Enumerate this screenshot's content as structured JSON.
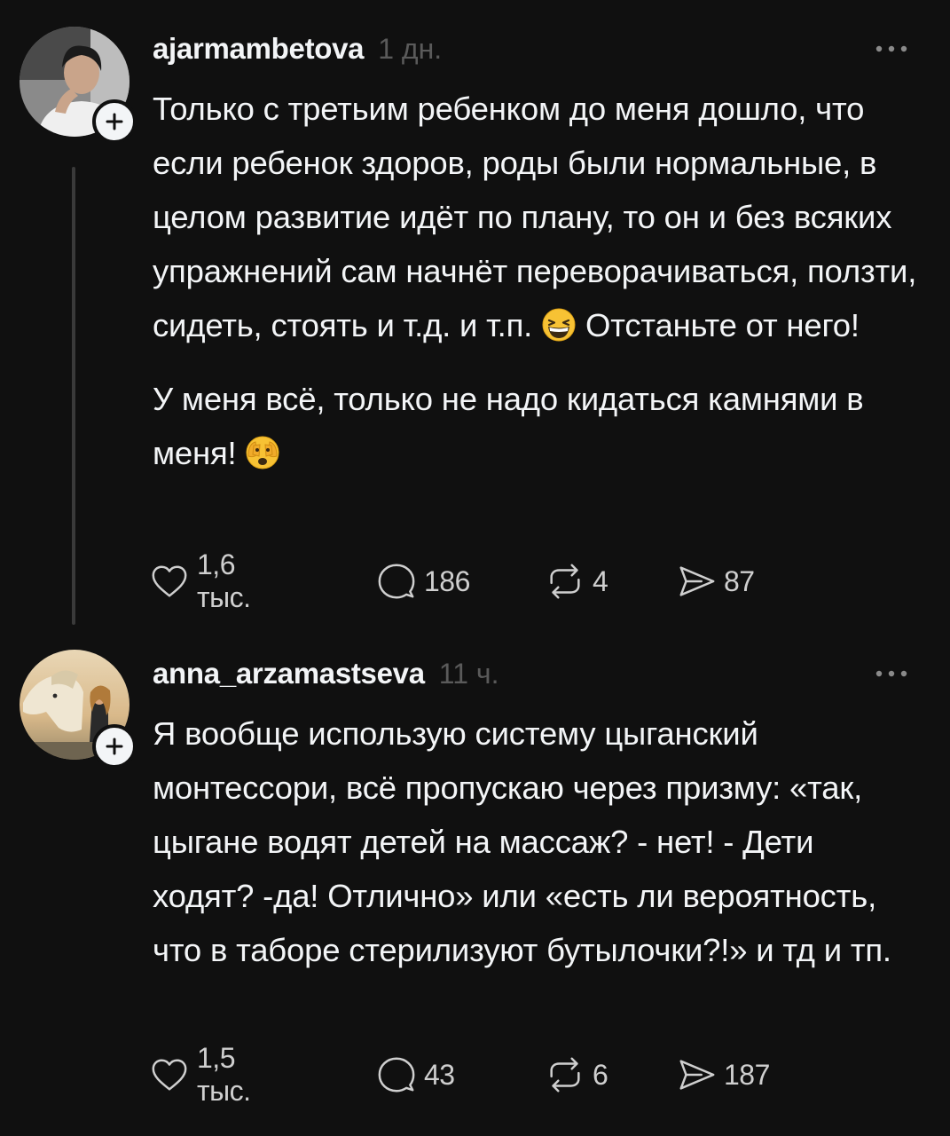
{
  "posts": [
    {
      "username": "ajarmambetova",
      "time": "1 дн.",
      "paragraphs": [
        {
          "text": "Только с третьим ребенком до меня дошло, что если ребенок здоров, роды были нормальные, в целом развитие идёт по плану, то он и без всяких упражнений сам начнёт переворачиваться, ползти, сидеть, стоять и т.д. и т.п.",
          "emoji": "grinning-squinting-face-emoji",
          "after": "Отстаньте от него!"
        },
        {
          "text": "У меня всё, только не надо кидаться камнями в меня!",
          "emoji": "face-with-peeking-eye-emoji",
          "after": ""
        }
      ],
      "likes": "1,6 тыс.",
      "replies": "186",
      "reposts": "4",
      "shares": "87"
    },
    {
      "username": "anna_arzamastseva",
      "time": "11 ч.",
      "paragraphs": [
        {
          "text": "Я вообще использую систему цыганский монтессори, всё пропускаю через призму: «так, цыгане водят детей на массаж? - нет! - Дети ходят? -да! Отлично» или «есть ли вероятность, что в таборе стерилизуют бутылочки?!» и тд и тп.",
          "emoji": "",
          "after": ""
        }
      ],
      "likes": "1,5 тыс.",
      "replies": "43",
      "reposts": "6",
      "shares": "187"
    }
  ],
  "icons": {
    "like": "heart-icon",
    "reply": "speech-bubble-icon",
    "repost": "repost-arrows-icon",
    "share": "send-icon",
    "more": "ellipsis-icon",
    "follow": "plus-icon"
  },
  "colors": {
    "background": "#101010",
    "text": "#f3f5f7",
    "muted": "#5a5a5a",
    "thread_line": "#3a3a3a"
  }
}
